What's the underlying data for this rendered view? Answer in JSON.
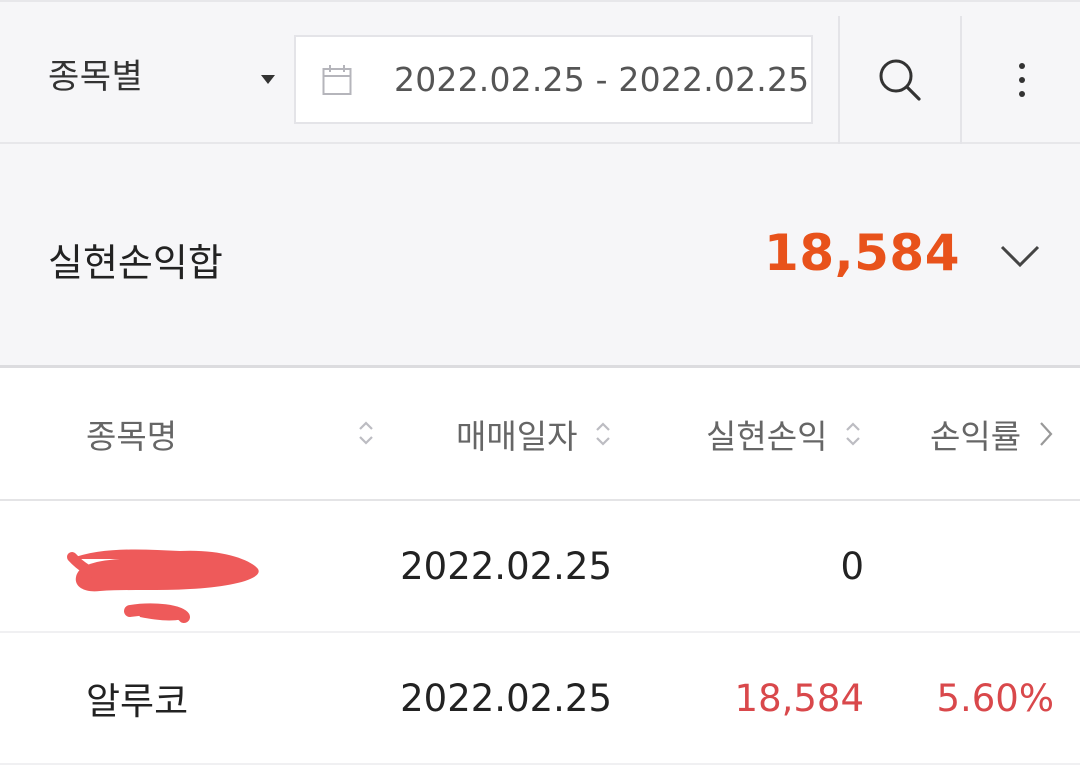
{
  "filter": {
    "group_by": "종목별",
    "date_range": "2022.02.25 - 2022.02.25"
  },
  "summary": {
    "label": "실현손익합",
    "value": "18,584",
    "value_color": "#e8521b"
  },
  "table": {
    "columns": [
      "종목명",
      "매매일자",
      "실현손익",
      "손익률"
    ],
    "rows": [
      {
        "name": "",
        "date": "2022.02.25",
        "profit": "0",
        "rate": ""
      },
      {
        "name": "알루코",
        "date": "2022.02.25",
        "profit": "18,584",
        "rate": "5.60%"
      }
    ]
  },
  "colors": {
    "accent_orange": "#e8521b",
    "profit_red": "#d9484b",
    "redaction": "#ee5a5a"
  },
  "icons": [
    "calendar-icon",
    "search-icon",
    "more-vertical-icon",
    "chevron-down-icon",
    "sort-icon",
    "chevron-right-icon"
  ]
}
